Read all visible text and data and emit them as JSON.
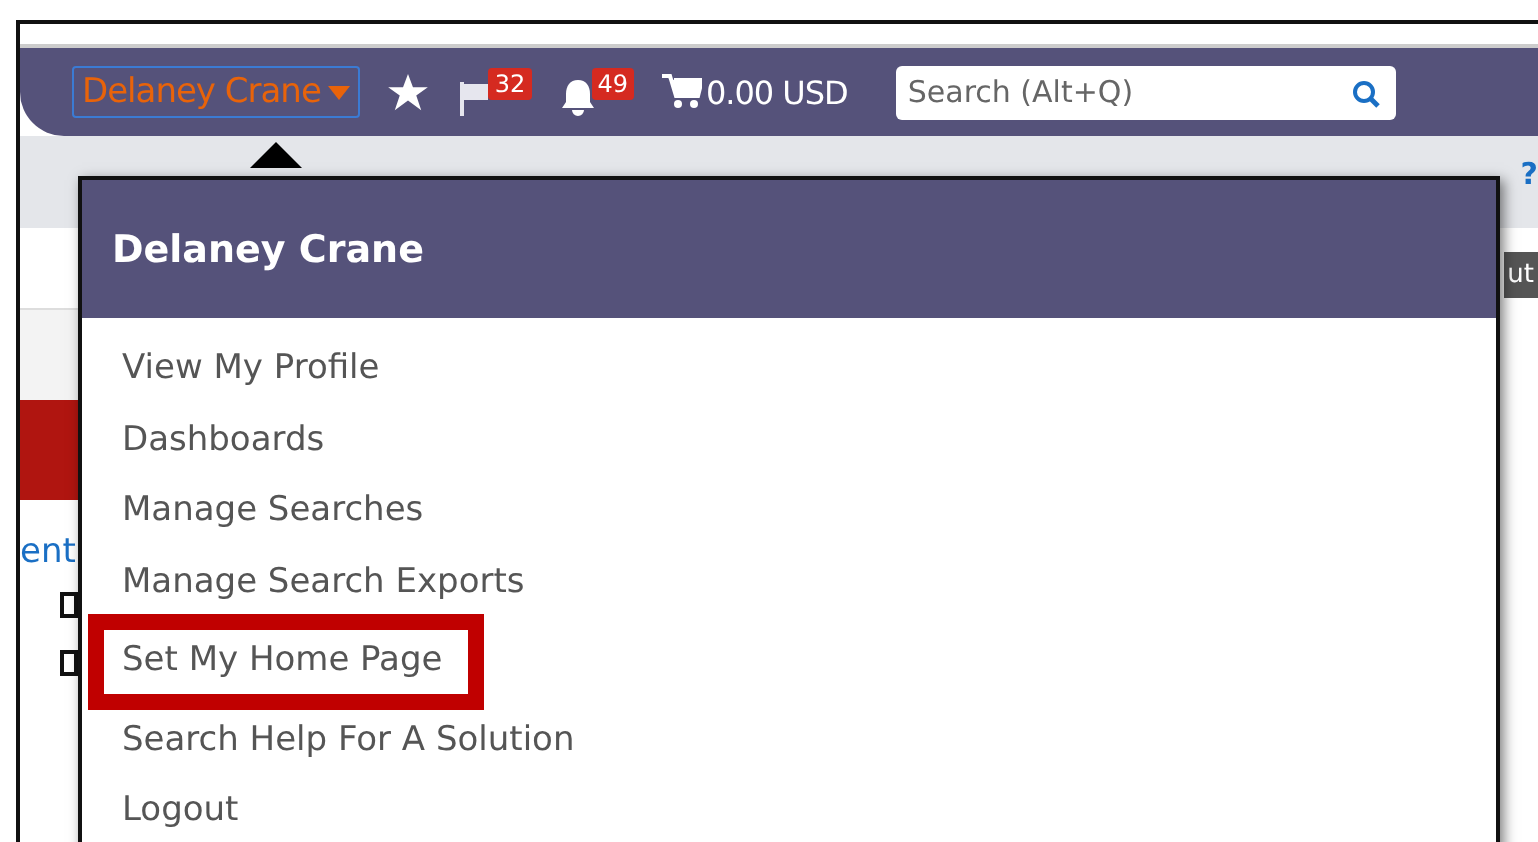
{
  "top_bar": {
    "user_menu": {
      "label": "Delaney Crane",
      "expanded": true
    },
    "flag_badge": "32",
    "bell_badge": "49",
    "cart": "0.00 USD",
    "search": {
      "placeholder": "Search (Alt+Q)"
    }
  },
  "background": {
    "help": "?",
    "partial_link": "ent",
    "partial_button": "ut"
  },
  "dropdown": {
    "title": "Delaney Crane",
    "items": [
      {
        "label": "View My Profile",
        "highlighted": false
      },
      {
        "label": "Dashboards",
        "highlighted": false
      },
      {
        "label": "Manage Searches",
        "highlighted": false
      },
      {
        "label": "Manage Search Exports",
        "highlighted": false
      },
      {
        "label": "Set My Home Page",
        "highlighted": true
      },
      {
        "label": "Search Help For A Solution",
        "highlighted": false
      },
      {
        "label": "Logout",
        "highlighted": false
      }
    ]
  }
}
